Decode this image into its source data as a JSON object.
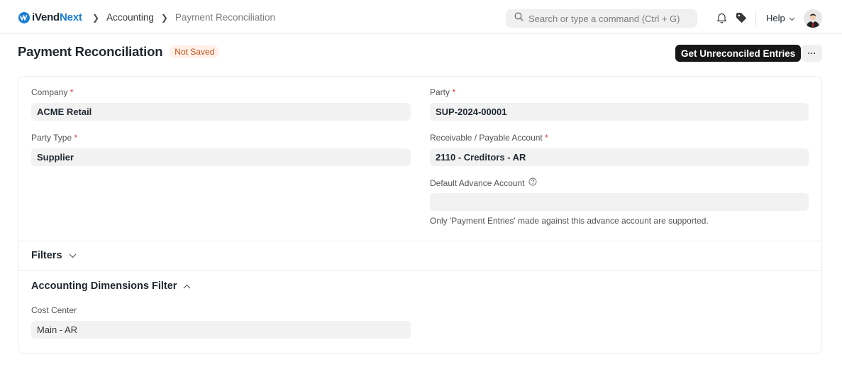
{
  "navbar": {
    "logo_text_1": "iVend",
    "logo_text_2": "Next",
    "breadcrumbs": [
      "Accounting",
      "Payment Reconciliation"
    ],
    "search_placeholder": "Search or type a command (Ctrl + G)",
    "help_label": "Help",
    "icons": [
      "search-icon",
      "bell-icon",
      "tag-icon",
      "chevron-down-icon",
      "avatar"
    ]
  },
  "page": {
    "title": "Payment Reconciliation",
    "status_badge": "Not Saved",
    "primary_action": "Get Unreconciled Entries",
    "more_label": "···"
  },
  "form": {
    "company": {
      "label": "Company",
      "required_mark": "*",
      "value": "ACME Retail"
    },
    "party_type": {
      "label": "Party Type",
      "required_mark": "*",
      "value": "Supplier"
    },
    "party": {
      "label": "Party",
      "required_mark": "*",
      "value": "SUP-2024-00001"
    },
    "receivable_payable_account": {
      "label": "Receivable / Payable Account",
      "required_mark": "*",
      "value": "2110 - Creditors - AR"
    },
    "default_advance_account": {
      "label": "Default Advance Account",
      "value": "",
      "help_text": "Only 'Payment Entries' made against this advance account are supported."
    }
  },
  "sections": {
    "filters": {
      "label": "Filters",
      "collapsed": true
    },
    "accounting_dimensions": {
      "label": "Accounting Dimensions Filter",
      "collapsed": false,
      "cost_center": {
        "label": "Cost Center",
        "value": "Main - AR"
      }
    }
  },
  "colors": {
    "brand": "#1a7fd4",
    "primary_button": "#171717",
    "badge_bg": "#fff0e8",
    "badge_text": "#c4501a",
    "required": "#e03636"
  }
}
